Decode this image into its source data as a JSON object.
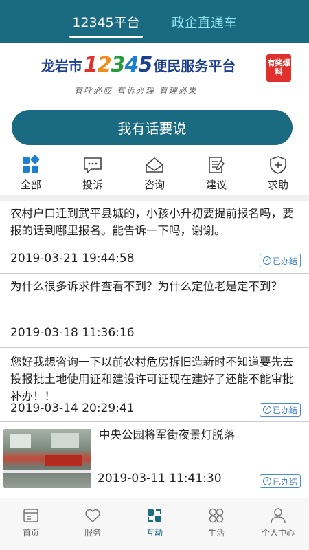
{
  "top_tabs": [
    {
      "label": "12345平台",
      "active": true
    },
    {
      "label": "政企直通车",
      "active": false
    }
  ],
  "banner": {
    "city": "龙岩市",
    "number_digits": [
      "1",
      "2",
      "3",
      "4",
      "5"
    ],
    "platform": "便民服务平台",
    "badge": "有奖爆料",
    "slogan": "有呼必应 有诉必理 有理必果"
  },
  "speak_button": "我有话要说",
  "categories": [
    {
      "label": "全部",
      "icon": "grid-icon",
      "active": true
    },
    {
      "label": "投诉",
      "icon": "chat-bubble-icon",
      "active": false
    },
    {
      "label": "咨询",
      "icon": "envelope-icon",
      "active": false
    },
    {
      "label": "建议",
      "icon": "document-edit-icon",
      "active": false
    },
    {
      "label": "求助",
      "icon": "shield-plus-icon",
      "active": false
    }
  ],
  "posts": [
    {
      "text": "农村户口迁到武平县城的，小孩小升初要提前报名吗，要报的话到哪里报名。能告诉一下吗，谢谢。",
      "time": "2019-03-21 19:44:58",
      "status": "已办结"
    },
    {
      "text": "为什么很多诉求件查看不到？为什么定位老是定不到？",
      "time": "2019-03-18 11:36:16",
      "status": ""
    },
    {
      "text": "您好我想咨询一下以前农村危房拆旧造新时不知道要先去投报批土地使用证和建设许可证现在建好了还能不能审批补办！！",
      "time": "2019-03-14 20:29:41",
      "status": "已办结"
    },
    {
      "text": "中央公园将军街夜景灯脱落",
      "time": "2019-03-11 11:41:30",
      "status": "已办结",
      "has_image": true
    }
  ],
  "bottom_tabs": [
    {
      "label": "首页",
      "icon": "home-icon",
      "active": false
    },
    {
      "label": "服务",
      "icon": "heart-icon",
      "active": false
    },
    {
      "label": "互动",
      "icon": "interact-icon",
      "active": true
    },
    {
      "label": "生活",
      "icon": "life-icon",
      "active": false
    },
    {
      "label": "个人中心",
      "icon": "person-icon",
      "active": false
    }
  ],
  "colors": {
    "primary": "#1a6a82",
    "status_blue": "#3a7fbf",
    "inactive_tab": "#8fe4ee"
  }
}
